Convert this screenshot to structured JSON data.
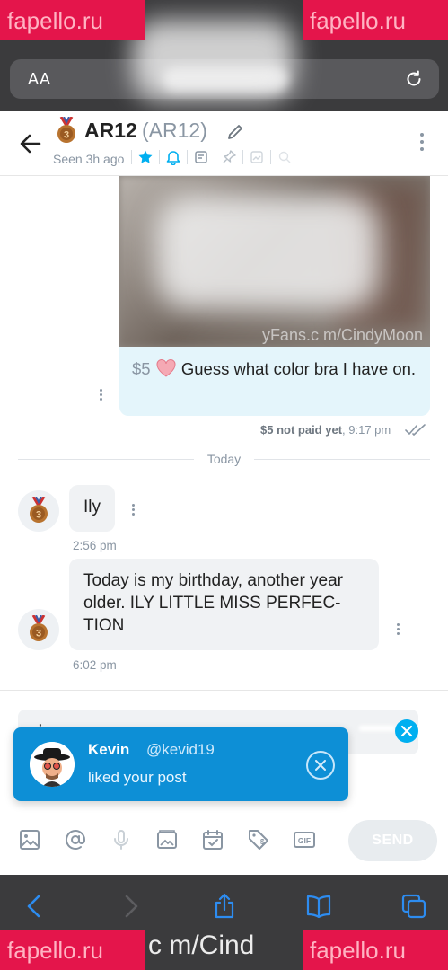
{
  "browser": {
    "aa_label": "AA",
    "watermark": "fapello.ru",
    "watermark_mid": "c m/Cind"
  },
  "header": {
    "name": "AR12",
    "handle": "(AR12)",
    "seen": "Seen 3h ago"
  },
  "messages": {
    "photo_watermark": "yFans.c m/CindyMoon",
    "paid": {
      "price": "$5",
      "text": " Guess what color bra I have on.",
      "status": "$5 not paid yet",
      "time": ", 9:17 pm"
    },
    "day_label": "Today",
    "incoming": [
      {
        "text": "Ily",
        "time": "2:56 pm"
      },
      {
        "text": "Today is my birthday, another year older. ILY LITTLE MISS PERFEC-TION",
        "time": "6:02 pm"
      }
    ]
  },
  "composer": {
    "typing": "․‧․"
  },
  "toast": {
    "name": "Kevin",
    "handle": "@kevid19",
    "message": "liked your post"
  },
  "toolbar": {
    "send_label": "SEND"
  },
  "colors": {
    "accent": "#00aff0",
    "toast_bg": "#0d8fd6",
    "paid_bubble": "#e4f5fb",
    "incoming_bubble": "#f0f2f4",
    "watermark_bg": "#e4154b"
  }
}
